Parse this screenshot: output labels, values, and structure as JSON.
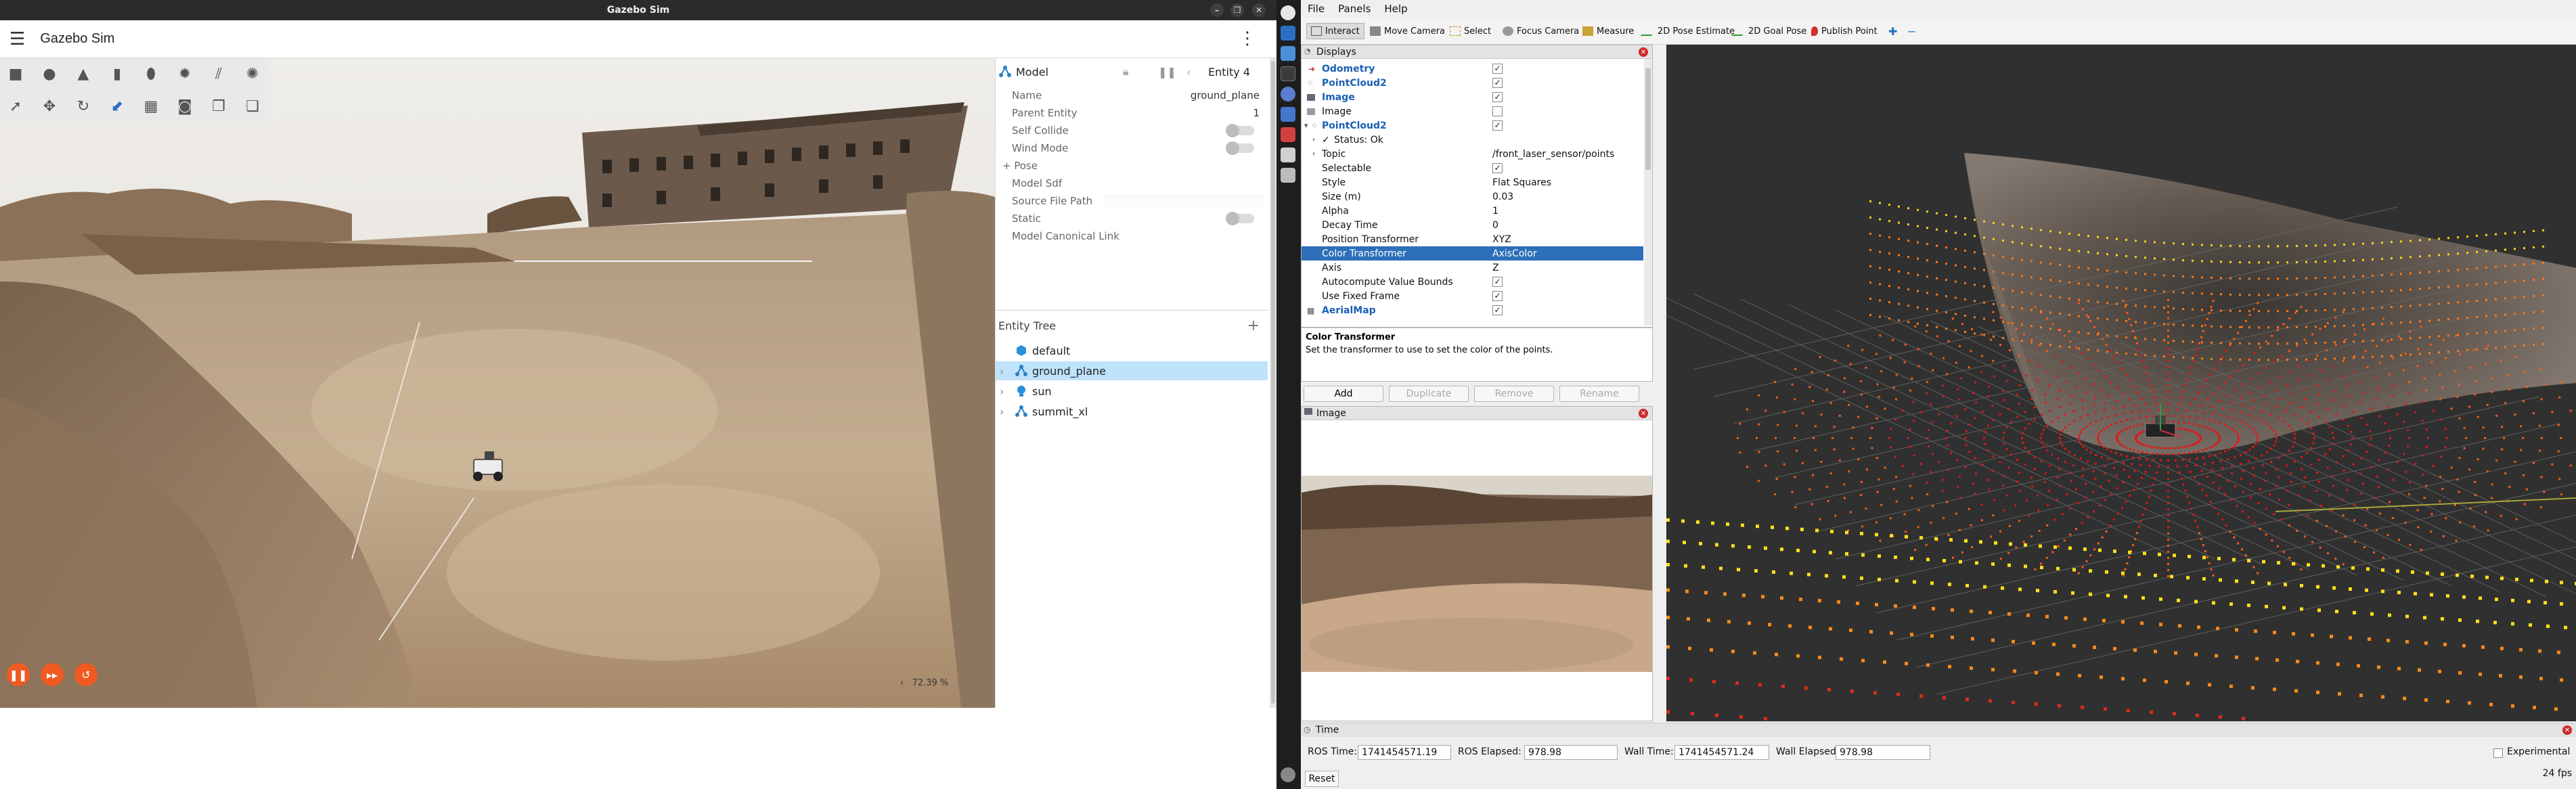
{
  "gazebo": {
    "window_title": "Gazebo Sim",
    "app_title": "Gazebo Sim",
    "rtf": "72.39 %",
    "component_panel": {
      "title": "Model",
      "entity": "Entity 4",
      "properties": [
        {
          "label": "Name",
          "value": "ground_plane"
        },
        {
          "label": "Parent Entity",
          "value": "1"
        },
        {
          "label": "Self Collide",
          "value": ""
        },
        {
          "label": "Wind Mode",
          "value": ""
        },
        {
          "label": "+ Pose",
          "value": ""
        },
        {
          "label": "Model Sdf",
          "value": ""
        },
        {
          "label": "Source File Path",
          "value": ""
        },
        {
          "label": "Static",
          "value": ""
        },
        {
          "label": "Model Canonical Link",
          "value": ""
        }
      ]
    },
    "entity_tree": {
      "title": "Entity Tree",
      "items": [
        "default",
        "ground_plane",
        "sun",
        "summit_xl"
      ]
    }
  },
  "rviz": {
    "menu": [
      "File",
      "Panels",
      "Help"
    ],
    "tools": [
      "Interact",
      "Move Camera",
      "Select",
      "Focus Camera",
      "Measure",
      "2D Pose Estimate",
      "2D Goal Pose",
      "Publish Point"
    ],
    "displays_title": "Displays",
    "displays": {
      "odometry": "Odometry",
      "pointcloud2_a": "PointCloud2",
      "image": "Image",
      "image2": "Image",
      "pointcloud2_b": "PointCloud2",
      "status": "Status: Ok",
      "topic_label": "Topic",
      "topic_value": "/front_laser_sensor/points",
      "selectable_label": "Selectable",
      "style_label": "Style",
      "style_value": "Flat Squares",
      "size_label": "Size (m)",
      "size_value": "0.03",
      "alpha_label": "Alpha",
      "alpha_value": "1",
      "decay_label": "Decay Time",
      "decay_value": "0",
      "pos_label": "Position Transformer",
      "pos_value": "XYZ",
      "color_label": "Color Transformer",
      "color_value": "AxisColor",
      "axis_label": "Axis",
      "axis_value": "Z",
      "auto_label": "Autocompute Value Bounds",
      "fixed_label": "Use Fixed Frame",
      "aerialmap": "AerialMap"
    },
    "description": {
      "title": "Color Transformer",
      "text": "Set the transformer to use to set the color of the points."
    },
    "buttons": [
      "Add",
      "Duplicate",
      "Remove",
      "Rename"
    ],
    "image_panel_title": "Image",
    "time": {
      "title": "Time",
      "ros_time_label": "ROS Time:",
      "ros_time": "1741454571.19",
      "ros_elapsed_label": "ROS Elapsed:",
      "ros_elapsed": "978.98",
      "wall_time_label": "Wall Time:",
      "wall_time": "1741454571.24",
      "wall_elapsed_label": "Wall Elapsed:",
      "wall_elapsed": "978.98",
      "experimental": "Experimental",
      "reset": "Reset",
      "fps": "24 fps"
    }
  }
}
